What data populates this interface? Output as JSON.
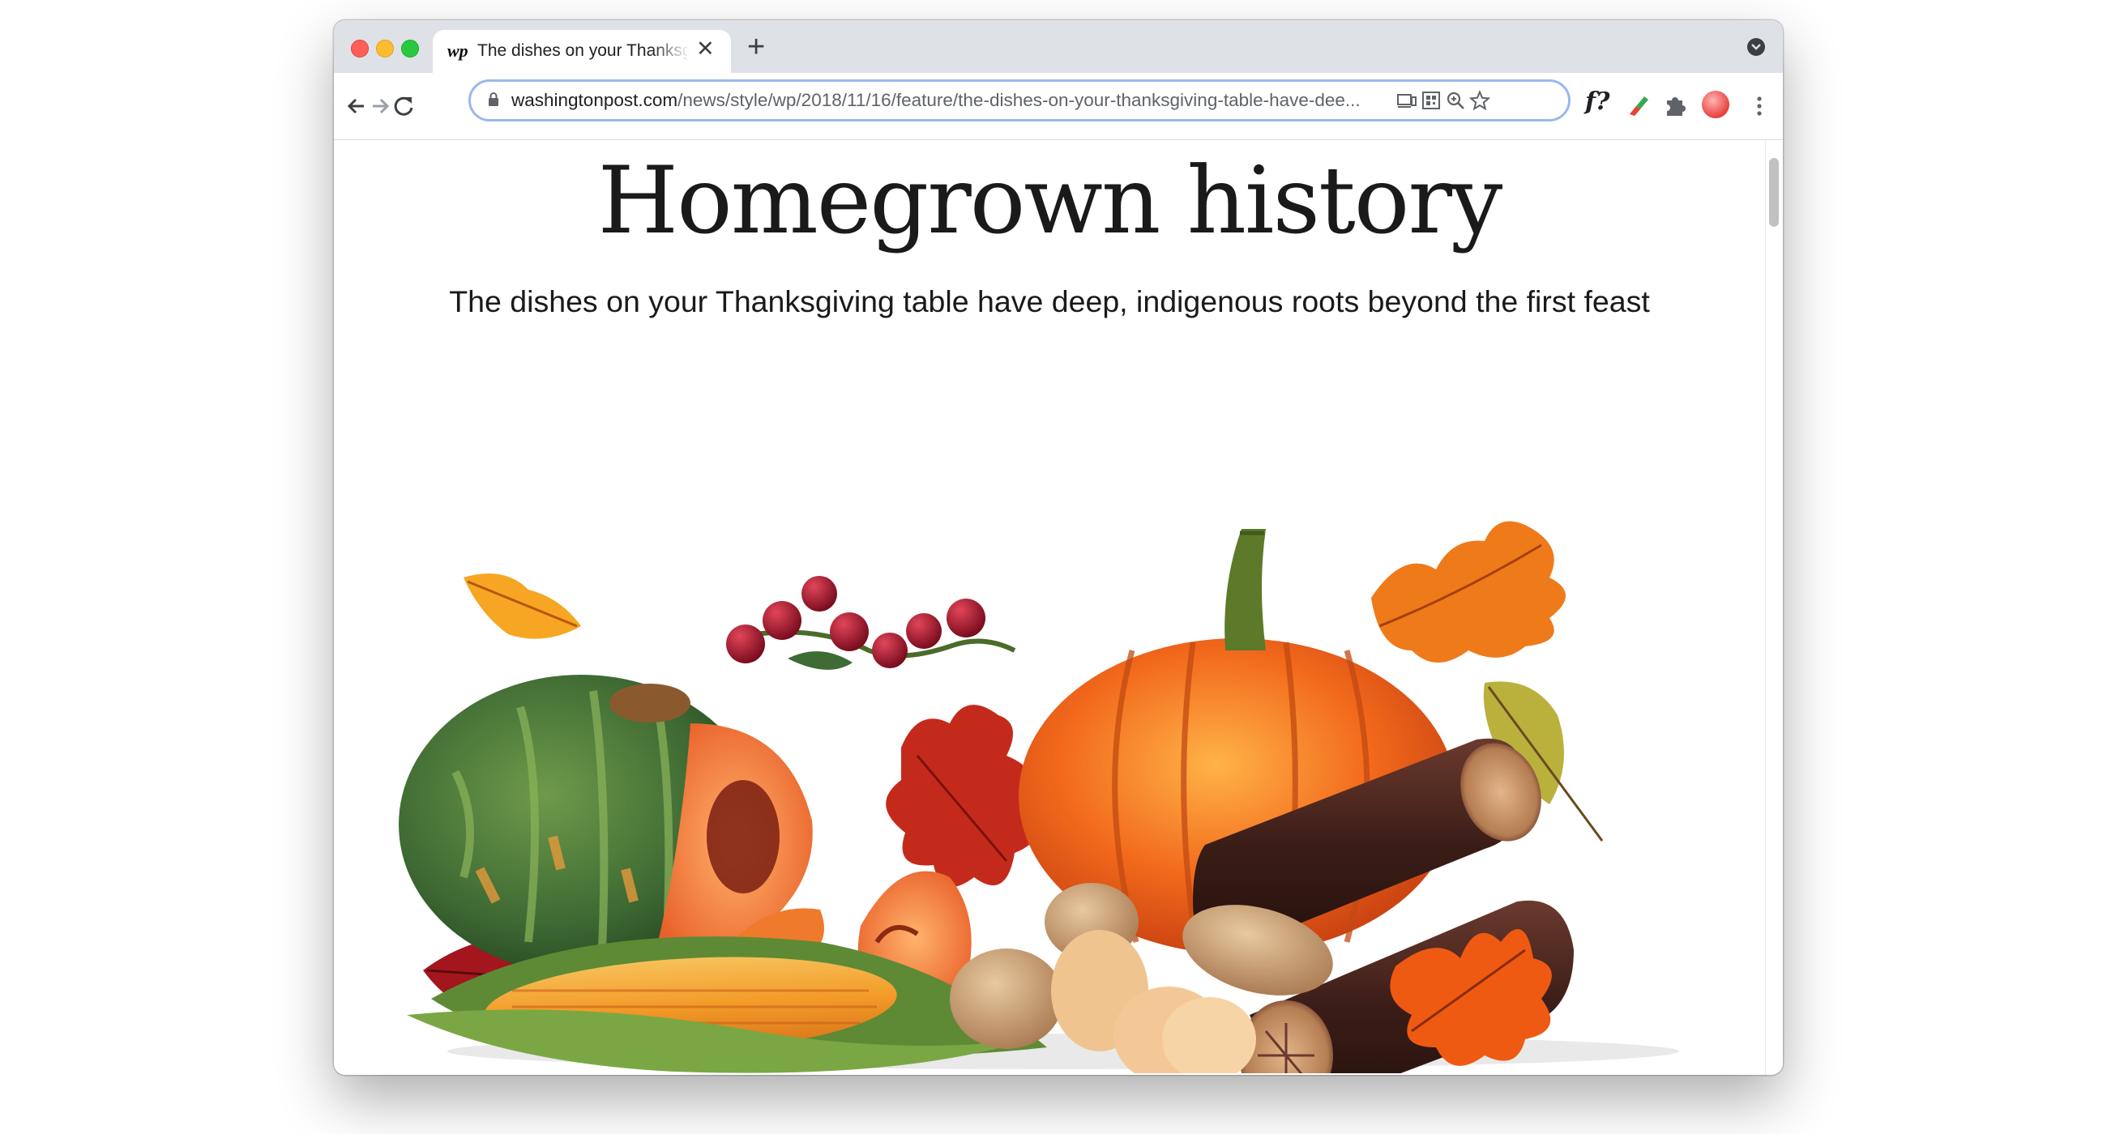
{
  "browser": {
    "tab": {
      "favicon": "wp",
      "title": "The dishes on your Thanksgiving table have deep, indigenous roots beyond the first feast",
      "close_symbol": "✕"
    },
    "new_tab_symbol": "+",
    "address_bar": {
      "host": "washingtonpost.com",
      "path": "/news/style/wp/2018/11/16/feature/the-dishes-on-your-thanksgiving-table-have-dee..."
    },
    "extension_label": "f?",
    "icons": [
      "back-arrow-icon",
      "forward-arrow-icon",
      "reload-icon",
      "lock-icon",
      "cast-icon",
      "qr-code-icon",
      "zoom-icon",
      "bookmark-star-icon",
      "extension-puzzle-icon",
      "profile-avatar-icon",
      "more-menu-icon",
      "tab-search-icon"
    ]
  },
  "article": {
    "headline": "Homegrown history",
    "subheadline": "The dishes on your Thanksgiving table have deep, indigenous roots beyond the first feast",
    "illustration_items": [
      "kabocha-squash",
      "cut-pumpkin-slice",
      "orange-pumpkin",
      "corn-cob",
      "potatoes",
      "wooden-logs",
      "cranberries",
      "autumn-leaves"
    ]
  },
  "colors": {
    "tabstrip": "#dee1e6",
    "omnibox_focus": "#9ab8ee",
    "pumpkin": "#f2691c",
    "squash_green": "#3f6b34",
    "corn": "#f39b28",
    "log_brown": "#3b1d17",
    "cranberry": "#a0152a"
  }
}
